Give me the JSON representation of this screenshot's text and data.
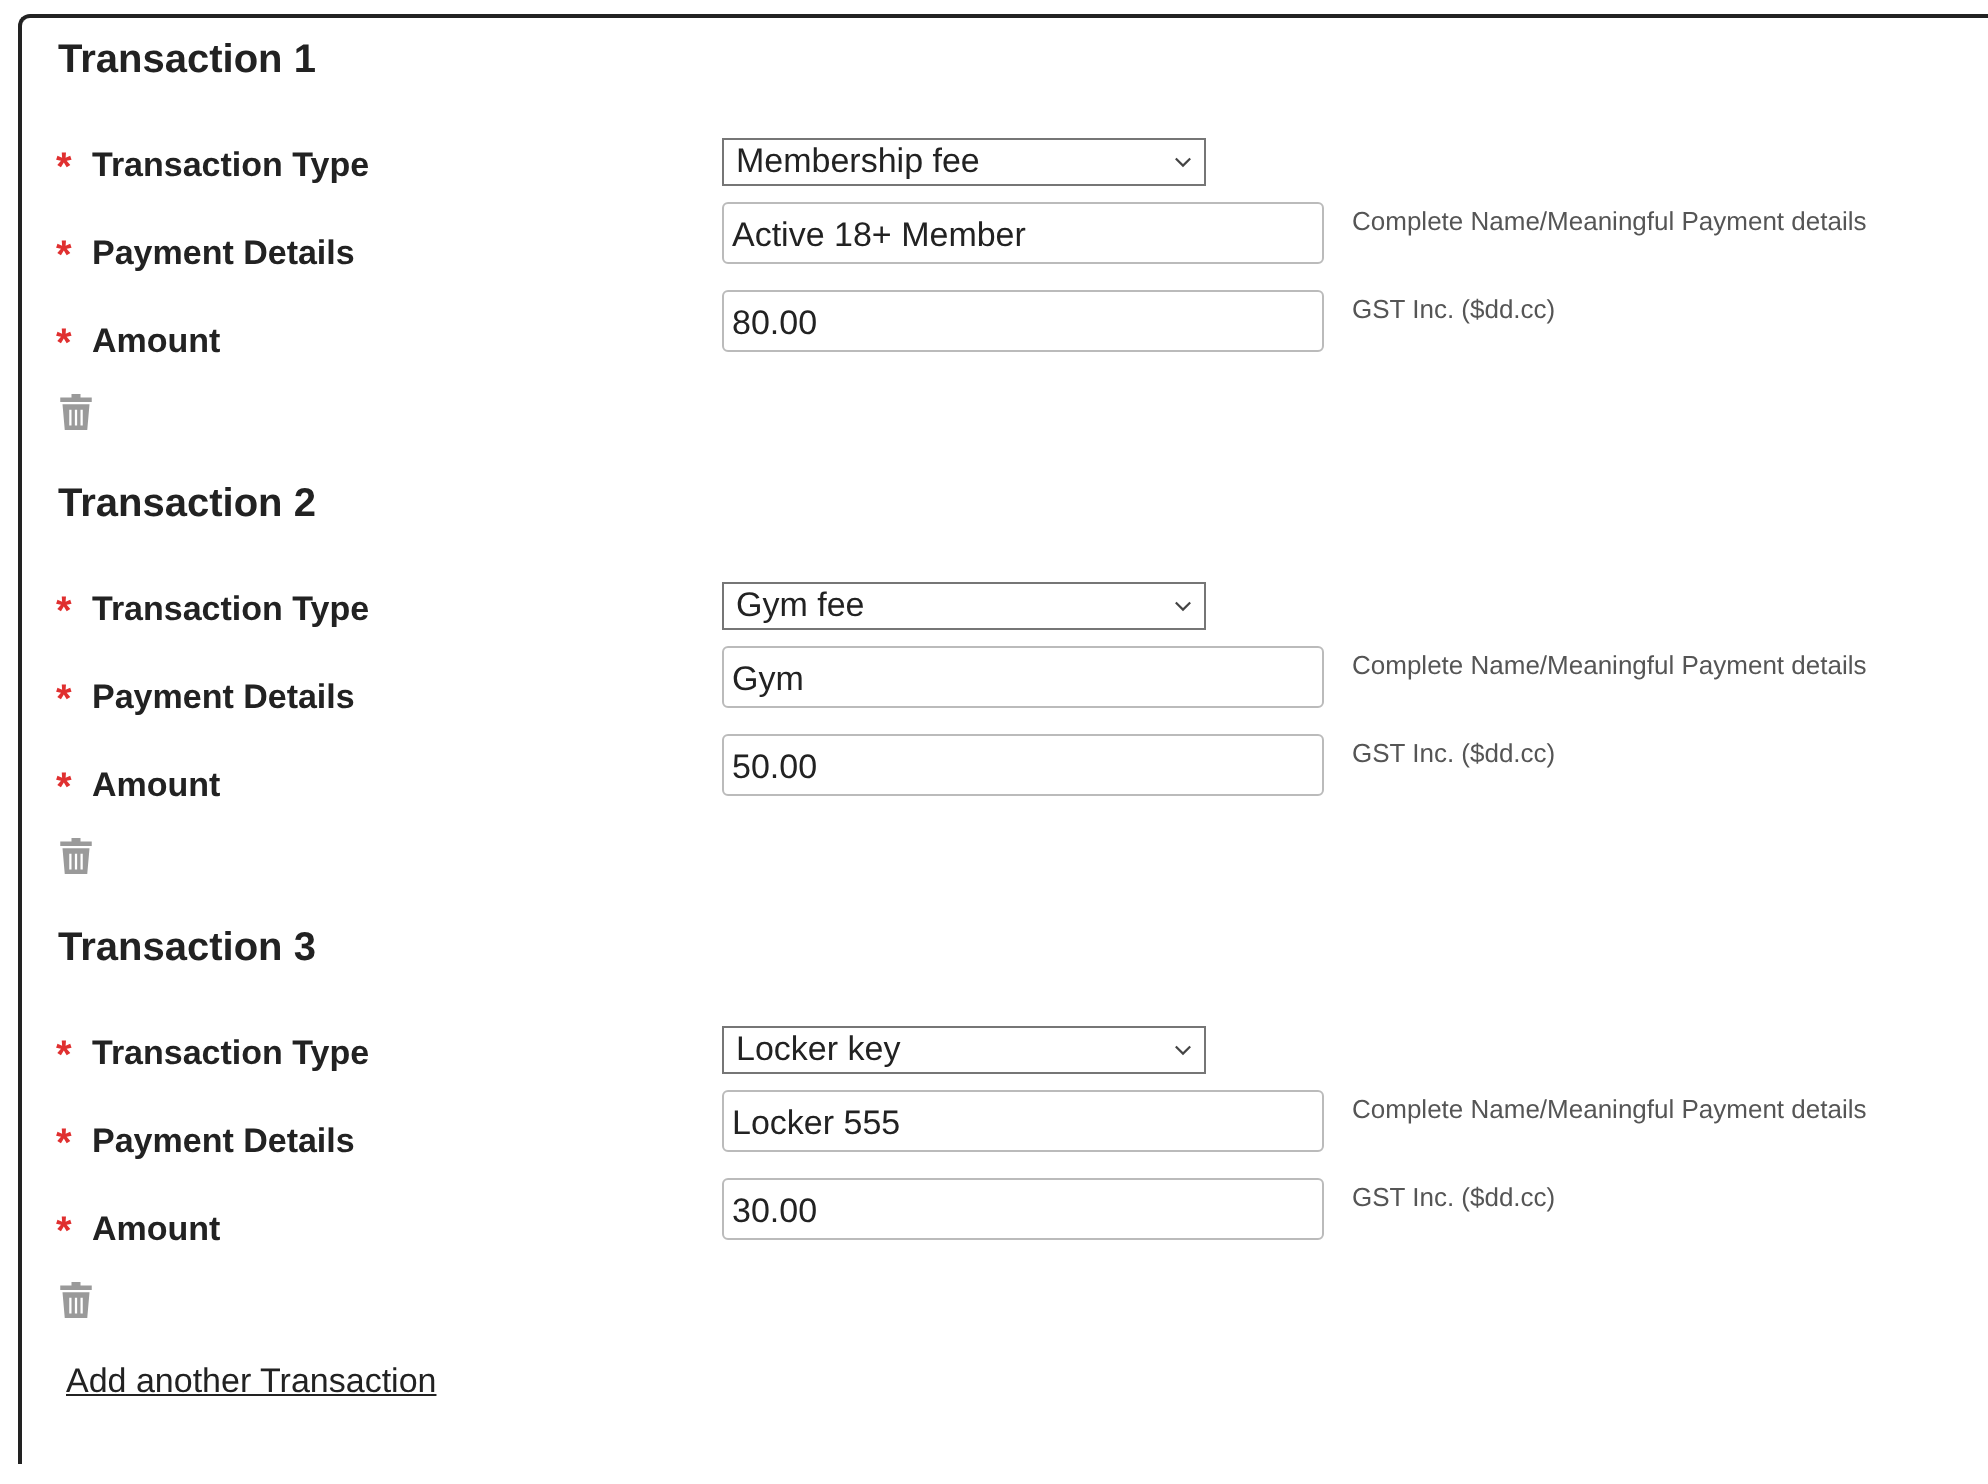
{
  "transactions": [
    {
      "title": "Transaction 1",
      "fields": [
        {
          "kind": "select",
          "required_mark": "*",
          "label": "Transaction Type",
          "value": "Membership fee"
        },
        {
          "kind": "text",
          "required_mark": "*",
          "label": "Payment Details",
          "value": "Active 18+ Member",
          "hint": "Complete Name/Meaningful Payment details"
        },
        {
          "kind": "text",
          "required_mark": "*",
          "label": "Amount",
          "value": "80.00",
          "hint": "GST Inc. ($dd.cc)"
        }
      ]
    },
    {
      "title": "Transaction 2",
      "fields": [
        {
          "kind": "select",
          "required_mark": "*",
          "label": "Transaction Type",
          "value": "Gym fee"
        },
        {
          "kind": "text",
          "required_mark": "*",
          "label": "Payment Details",
          "value": "Gym",
          "hint": "Complete Name/Meaningful Payment details"
        },
        {
          "kind": "text",
          "required_mark": "*",
          "label": "Amount",
          "value": "50.00",
          "hint": "GST Inc. ($dd.cc)"
        }
      ]
    },
    {
      "title": "Transaction 3",
      "fields": [
        {
          "kind": "select",
          "required_mark": "*",
          "label": "Transaction Type",
          "value": "Locker key"
        },
        {
          "kind": "text",
          "required_mark": "*",
          "label": "Payment Details",
          "value": "Locker 555",
          "hint": "Complete Name/Meaningful Payment details"
        },
        {
          "kind": "text",
          "required_mark": "*",
          "label": "Amount",
          "value": "30.00",
          "hint": "GST Inc. ($dd.cc)"
        }
      ]
    }
  ],
  "add_link": "Add another Transaction"
}
